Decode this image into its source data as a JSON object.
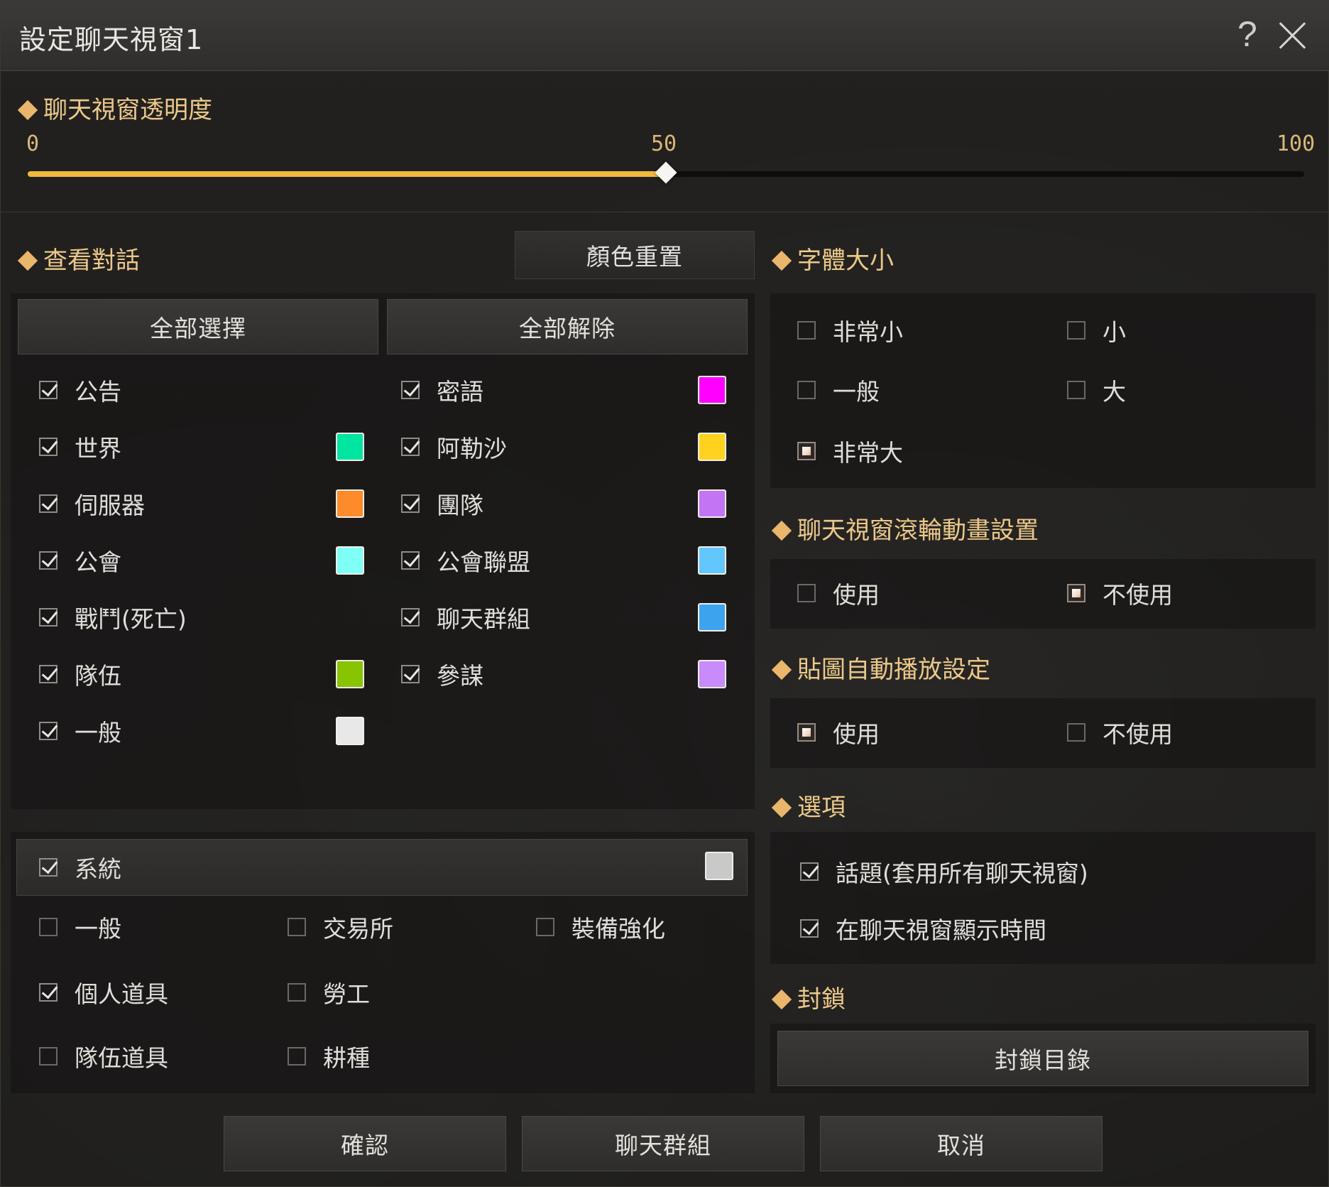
{
  "window": {
    "title": "設定聊天視窗1",
    "help_icon": "?"
  },
  "transparency": {
    "title": "聊天視窗透明度",
    "min_label": "0",
    "current_label": "50",
    "max_label": "100",
    "value": 50,
    "min": 0,
    "max": 100
  },
  "view_chat": {
    "title": "查看對話",
    "color_reset_label": "顏色重置",
    "select_all_label": "全部選擇",
    "deselect_all_label": "全部解除",
    "channels": [
      {
        "label": "公告",
        "checked": true,
        "color": null
      },
      {
        "label": "密語",
        "checked": true,
        "color": "#ff00ff"
      },
      {
        "label": "世界",
        "checked": true,
        "color": "#00e5a0"
      },
      {
        "label": "阿勒沙",
        "checked": true,
        "color": "#ffd21e"
      },
      {
        "label": "伺服器",
        "checked": true,
        "color": "#ff8a2a"
      },
      {
        "label": "團隊",
        "checked": true,
        "color": "#c274f5"
      },
      {
        "label": "公會",
        "checked": true,
        "color": "#7ffff5"
      },
      {
        "label": "公會聯盟",
        "checked": true,
        "color": "#62c6ff"
      },
      {
        "label": "戰鬥(死亡)",
        "checked": true,
        "color": null
      },
      {
        "label": "聊天群組",
        "checked": true,
        "color": "#3ca4ee"
      },
      {
        "label": "隊伍",
        "checked": true,
        "color": "#88c400"
      },
      {
        "label": "參謀",
        "checked": true,
        "color": "#c98afc"
      },
      {
        "label": "一般",
        "checked": true,
        "color": "#e8e8e8"
      }
    ],
    "system": {
      "label": "系統",
      "checked": true,
      "color": "#c9c9c9",
      "items": [
        {
          "label": "一般",
          "checked": false
        },
        {
          "label": "交易所",
          "checked": false
        },
        {
          "label": "裝備強化",
          "checked": false
        },
        {
          "label": "個人道具",
          "checked": true
        },
        {
          "label": "勞工",
          "checked": false
        },
        {
          "label": "隊伍道具",
          "checked": false
        },
        {
          "label": "耕種",
          "checked": false
        }
      ]
    }
  },
  "font_size": {
    "title": "字體大小",
    "options": [
      {
        "label": "非常小",
        "selected": false
      },
      {
        "label": "小",
        "selected": false
      },
      {
        "label": "一般",
        "selected": false
      },
      {
        "label": "大",
        "selected": false
      },
      {
        "label": "非常大",
        "selected": true
      }
    ]
  },
  "scroll_animation": {
    "title": "聊天視窗滾輪動畫設置",
    "options": [
      {
        "label": "使用",
        "selected": false
      },
      {
        "label": "不使用",
        "selected": true
      }
    ]
  },
  "sticker_autoplay": {
    "title": "貼圖自動播放設定",
    "options": [
      {
        "label": "使用",
        "selected": true
      },
      {
        "label": "不使用",
        "selected": false
      }
    ]
  },
  "options": {
    "title": "選項",
    "items": [
      {
        "label": "話題(套用所有聊天視窗)",
        "checked": true
      },
      {
        "label": "在聊天視窗顯示時間",
        "checked": true
      }
    ]
  },
  "block": {
    "title": "封鎖",
    "block_list_label": "封鎖目錄"
  },
  "footer": {
    "confirm_label": "確認",
    "chat_group_label": "聊天群組",
    "cancel_label": "取消"
  },
  "colors": {
    "accent": "#f2b93c",
    "section_title": "#ecc98a"
  }
}
